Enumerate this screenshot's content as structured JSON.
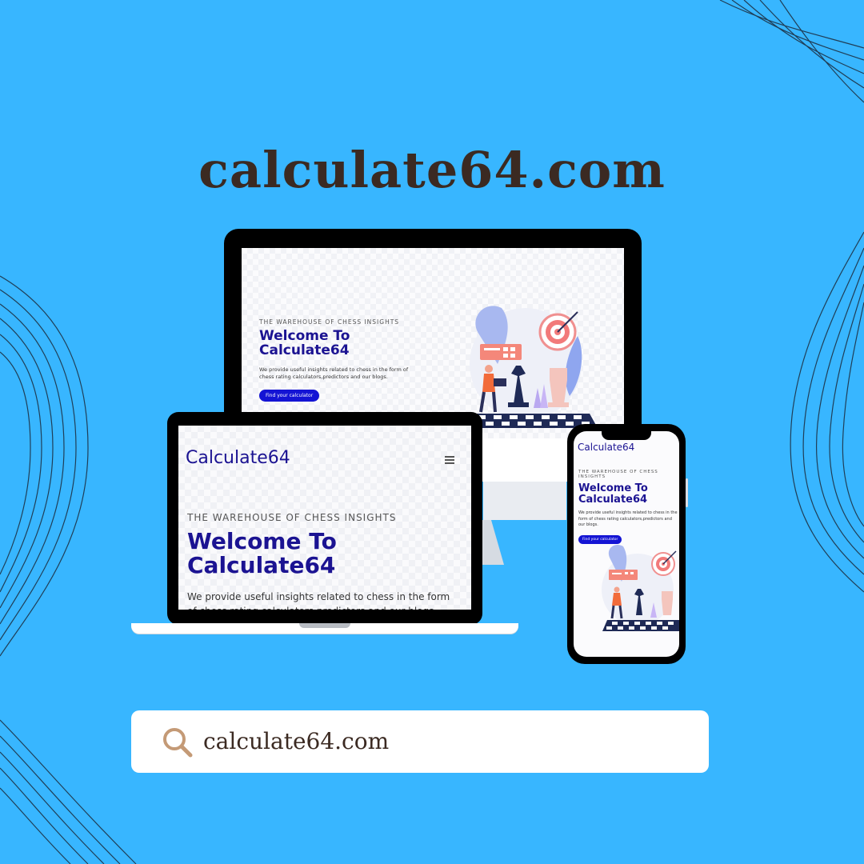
{
  "colors": {
    "background": "#38b6ff",
    "title": "#3b2a22",
    "brand_navy": "#1b1392",
    "cta_blue": "#1414d4",
    "search_icon": "#c49a76"
  },
  "title": "calculate64.com",
  "site": {
    "brand": "Calculate64",
    "eyebrow": "THE WAREHOUSE OF CHESS INSIGHTS",
    "headline_line1": "Welcome To",
    "headline_line2": "Calculate64",
    "description": "We provide useful insights related to chess in the form of chess rating calculators,predictors and our blogs.",
    "laptop_description": "We provide useful insights related to chess in the form of chess rating calculators,predictors and our blogs.",
    "cta": "Find your calculator",
    "menu_icon": "hamburger-menu-icon"
  },
  "search": {
    "icon": "search-icon",
    "text": "calculate64.com"
  }
}
